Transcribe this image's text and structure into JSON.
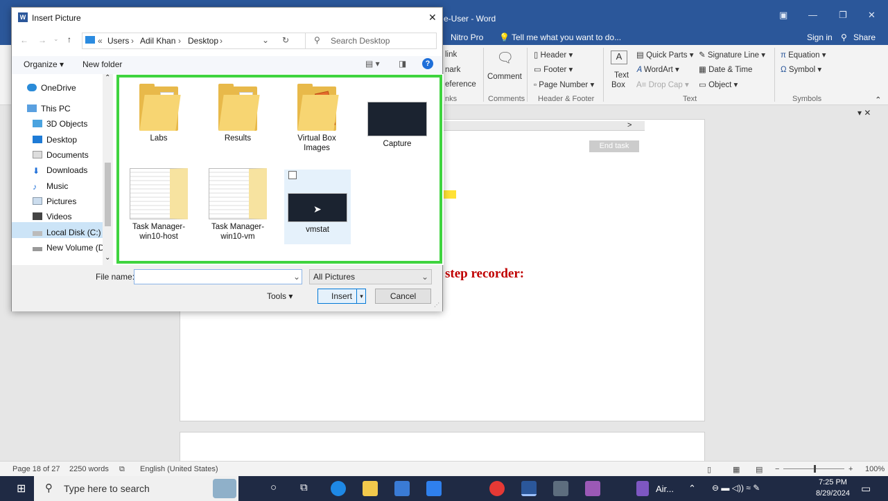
{
  "word": {
    "title_fragment": "e-User - Word",
    "menu": {
      "nitro": "Nitro Pro",
      "tell_me": "Tell me what you want to do...",
      "sign_in": "Sign in",
      "share": "Share"
    },
    "ribbon": {
      "links_partial": [
        "link",
        "nark",
        "eference"
      ],
      "links_group_partial": "nks",
      "comment": "Comment",
      "comments_group": "Comments",
      "header": "Header",
      "footer": "Footer",
      "page_number": "Page Number",
      "header_footer_group": "Header & Footer",
      "text_box_1": "Text",
      "text_box_2": "Box",
      "quick_parts": "Quick Parts",
      "wordart": "WordArt",
      "drop_cap": "Drop Cap",
      "signature_line": "Signature Line",
      "date_time": "Date & Time",
      "object": "Object",
      "text_group": "Text",
      "equation": "Equation",
      "symbol": "Symbol",
      "symbols_group": "Symbols"
    },
    "doc": {
      "end_task": "End task",
      "heading_fragment": "step recorder:",
      "chevron": ">"
    },
    "status": {
      "page": "Page 18 of 27",
      "words": "2250 words",
      "language": "English (United States)",
      "zoom": "100%"
    }
  },
  "dialog": {
    "title": "Insert Picture",
    "breadcrumb": [
      "Users",
      "Adil Khan",
      "Desktop"
    ],
    "search_placeholder": "Search Desktop",
    "toolbar": {
      "organize": "Organize",
      "new_folder": "New folder"
    },
    "nav_items": [
      "OneDrive",
      "This PC",
      "3D Objects",
      "Desktop",
      "Documents",
      "Downloads",
      "Music",
      "Pictures",
      "Videos",
      "Local Disk (C:)",
      "New Volume (D:"
    ],
    "files": [
      {
        "name": "Labs",
        "kind": "folder"
      },
      {
        "name": "Results",
        "kind": "folder"
      },
      {
        "name": "Virtual Box Images",
        "kind": "folder"
      },
      {
        "name": "Capture",
        "kind": "image"
      },
      {
        "name": "Task Manager-win10-host",
        "kind": "image"
      },
      {
        "name": "Task Manager-win10-vm",
        "kind": "image"
      },
      {
        "name": "vmstat",
        "kind": "image"
      }
    ],
    "file_name_label": "File name:",
    "file_name_value": "",
    "filter": "All Pictures",
    "tools": "Tools",
    "insert": "Insert",
    "cancel": "Cancel"
  },
  "taskbar": {
    "search_placeholder": "Type here to search",
    "air_label": "Air...",
    "time": "7:25 PM",
    "date": "8/29/2024"
  },
  "colors": {
    "word_blue": "#2b579a",
    "highlight": "#3fd43f",
    "heading_red": "#c00000"
  }
}
